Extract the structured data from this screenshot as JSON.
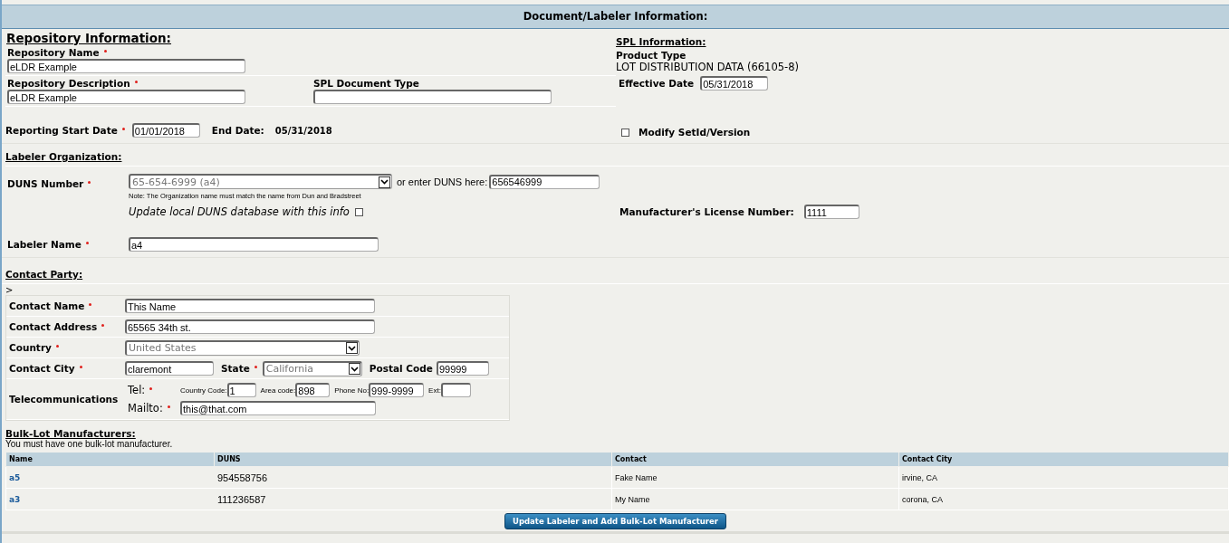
{
  "header": {
    "title": "Document/Labeler Information:"
  },
  "repository": {
    "heading": "Repository Information:",
    "name": {
      "label": {
        "text": "Repository Name",
        "required": true
      },
      "value": "eLDR Example"
    },
    "description": {
      "label": {
        "text": "Repository Description",
        "required": true
      },
      "value": "eLDR Example"
    },
    "spl_document_type": {
      "label": {
        "text": "SPL Document Type",
        "required": false
      }
    },
    "start_date": {
      "label": {
        "text": "Reporting Start Date",
        "required": true
      },
      "value": "01/01/2018"
    },
    "end_date": {
      "label": "End Date:",
      "value": "05/31/2018"
    }
  },
  "spl_information": {
    "heading": "SPL Information:",
    "product_type_label": "Product Type",
    "product_type": "LOT DISTRIBUTION DATA (66105-8)",
    "effective_date": {
      "label": {
        "text": "Effective Date",
        "required": false
      },
      "value": "05/31/2018"
    },
    "modify": {
      "label": "Modify SetId/Version",
      "checked": false
    }
  },
  "labeler": {
    "heading": "Labeler Organization:",
    "duns": {
      "label": {
        "text": "DUNS Number",
        "required": true
      },
      "selected_option": "65-654-6999 (a4)",
      "enter_label": "or enter DUNS here:",
      "enter_value": "656546999"
    },
    "note": "Note: The Organization name must match the name from Dun and Bradstreet",
    "update_local": {
      "label": "Update local DUNS database with this info",
      "checked": false
    },
    "license": {
      "label": {
        "text": "Manufacturer's License Number:",
        "required": false
      },
      "value": "1111"
    },
    "name": {
      "label": {
        "text": "Labeler Name",
        "required": true
      },
      "value": "a4"
    }
  },
  "contact": {
    "heading": "Contact Party:",
    "marker": ">",
    "name": {
      "label": {
        "text": "Contact Name",
        "required": true
      },
      "value": "This Name"
    },
    "address": {
      "label": {
        "text": "Contact Address",
        "required": true
      },
      "value": "65565 34th st."
    },
    "country": {
      "label": {
        "text": "Country",
        "required": true
      },
      "selected_option": "United States"
    },
    "city": {
      "label": {
        "text": "Contact City",
        "required": true
      },
      "value": "claremont"
    },
    "state": {
      "label": {
        "text": "State",
        "required": true
      },
      "selected_option": "California"
    },
    "postal_code": {
      "label": {
        "text": "Postal Code",
        "required": false
      },
      "value": "99999"
    },
    "telecom": {
      "label": "Telecommunications",
      "tel_label": {
        "text": "Tel:",
        "required": true
      },
      "country_code": {
        "label": "Country Code:",
        "value": "1"
      },
      "area_code": {
        "label": "Area code:",
        "value": "898"
      },
      "phone": {
        "label": "Phone No:",
        "value": "999-9999"
      },
      "ext": {
        "label": "Ext:"
      },
      "mailto_label": {
        "text": "Mailto:",
        "required": true
      },
      "mailto": "this@that.com"
    }
  },
  "bulk_lot": {
    "heading": "Bulk-Lot Manufacturers:",
    "note": "You must have one bulk-lot manufacturer.",
    "columns": [
      "Name",
      "DUNS",
      "Contact",
      "Contact City"
    ],
    "rows": [
      [
        "a5",
        "954558756",
        "Fake Name",
        "irvine, CA"
      ],
      [
        "a3",
        "111236587",
        "My Name",
        "corona, CA"
      ]
    ],
    "button": "Update Labeler and Add Bulk-Lot Manufacturer"
  }
}
